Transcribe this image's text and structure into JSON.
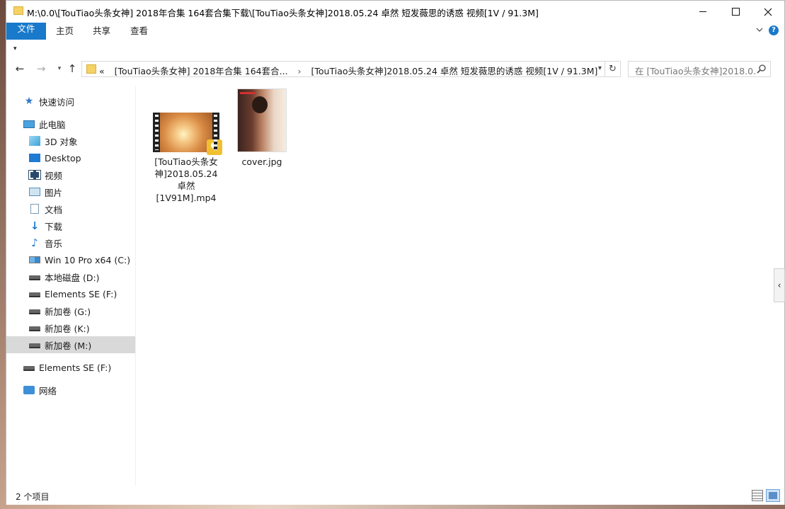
{
  "window": {
    "title": "M:\\0.0\\[TouTiao头条女神] 2018年合集 164套合集下载\\[TouTiao头条女神]2018.05.24 卓然 短发薇思的诱惑 视频[1V / 91.3M]"
  },
  "ribbon": {
    "tabs": [
      "文件",
      "主页",
      "共享",
      "查看"
    ],
    "active_color": "#1979ca"
  },
  "address_bar": {
    "prefix": "«",
    "segments": [
      "[TouTiao头条女神] 2018年合集 164套合...",
      "[TouTiao头条女神]2018.05.24 卓然 短发薇思的诱惑 视频[1V / 91.3M]"
    ],
    "separator": "›"
  },
  "search": {
    "placeholder": "在 [TouTiao头条女神]2018.0..."
  },
  "sidebar": {
    "items": [
      {
        "label": "快速访问",
        "icon": "star-icon"
      },
      {
        "label": "此电脑",
        "icon": "computer-icon"
      },
      {
        "label": "3D 对象",
        "icon": "3d-objects-icon"
      },
      {
        "label": "Desktop",
        "icon": "desktop-icon"
      },
      {
        "label": "视频",
        "icon": "video-icon"
      },
      {
        "label": "图片",
        "icon": "picture-icon"
      },
      {
        "label": "文档",
        "icon": "document-icon"
      },
      {
        "label": "下载",
        "icon": "download-icon"
      },
      {
        "label": "音乐",
        "icon": "music-icon"
      },
      {
        "label": "Win 10 Pro x64 (C:)",
        "icon": "windows-drive-icon"
      },
      {
        "label": "本地磁盘 (D:)",
        "icon": "drive-icon"
      },
      {
        "label": "Elements SE (F:)",
        "icon": "drive-icon"
      },
      {
        "label": "新加卷 (G:)",
        "icon": "drive-icon"
      },
      {
        "label": "新加卷 (K:)",
        "icon": "drive-icon"
      },
      {
        "label": "新加卷 (M:)",
        "icon": "drive-icon",
        "selected": true
      },
      {
        "label": "Elements SE (F:)",
        "icon": "drive-icon"
      },
      {
        "label": "网络",
        "icon": "network-icon"
      }
    ]
  },
  "files": [
    {
      "name": "[TouTiao头条女神]2018.05.24 卓然 [1V91M].mp4",
      "name_lines": [
        "[TouTiao头条女",
        "神]2018.05.24",
        "卓然",
        "[1V91M].mp4"
      ],
      "type": "video"
    },
    {
      "name": "cover.jpg",
      "type": "image"
    }
  ],
  "video_thumb_badge": "Player",
  "status": {
    "item_count": "2 个项目"
  }
}
